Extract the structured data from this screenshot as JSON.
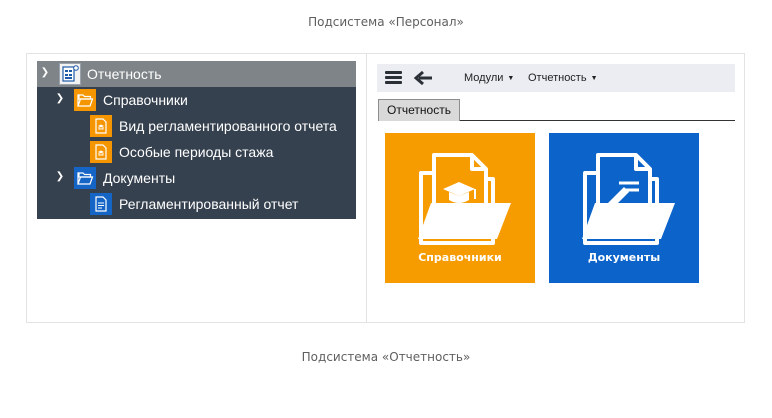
{
  "captions": {
    "top": "Подсистема «Персонал»",
    "bottom": "Подсистема «Отчетность»"
  },
  "tree": {
    "items": [
      {
        "label": "Отчетность",
        "level": 0,
        "expanded": true,
        "selected": true,
        "icon": "report-module-icon"
      },
      {
        "label": "Справочники",
        "level": 1,
        "expanded": true,
        "selected": false,
        "icon": "open-folder-icon"
      },
      {
        "label": "Вид регламентированного отчета",
        "level": 2,
        "selected": false,
        "icon": "catalog-document-icon"
      },
      {
        "label": "Особые периоды стажа",
        "level": 2,
        "selected": false,
        "icon": "catalog-document-icon"
      },
      {
        "label": "Документы",
        "level": 1,
        "expanded": true,
        "selected": false,
        "icon": "open-folder-icon"
      },
      {
        "label": "Регламентированный отчет",
        "level": 2,
        "selected": false,
        "icon": "document-icon"
      }
    ]
  },
  "toolbar": {
    "menus": [
      {
        "label": "Модули",
        "icon": "caret-down-icon"
      },
      {
        "label": "Отчетность",
        "icon": "caret-down-icon"
      }
    ]
  },
  "tab": {
    "label": "Отчетность"
  },
  "tiles": [
    {
      "label": "Справочники",
      "color": "#f69c00",
      "icon": "catalog-folder-icon"
    },
    {
      "label": "Документы",
      "color": "#0c63c9",
      "icon": "documents-folder-icon"
    }
  ],
  "colors": {
    "tree_background": "#36414f",
    "tree_selected": "#7f8488",
    "accent_orange": "#f69c00",
    "accent_blue": "#0c63c9",
    "toolbar_background": "#ebedf3"
  }
}
